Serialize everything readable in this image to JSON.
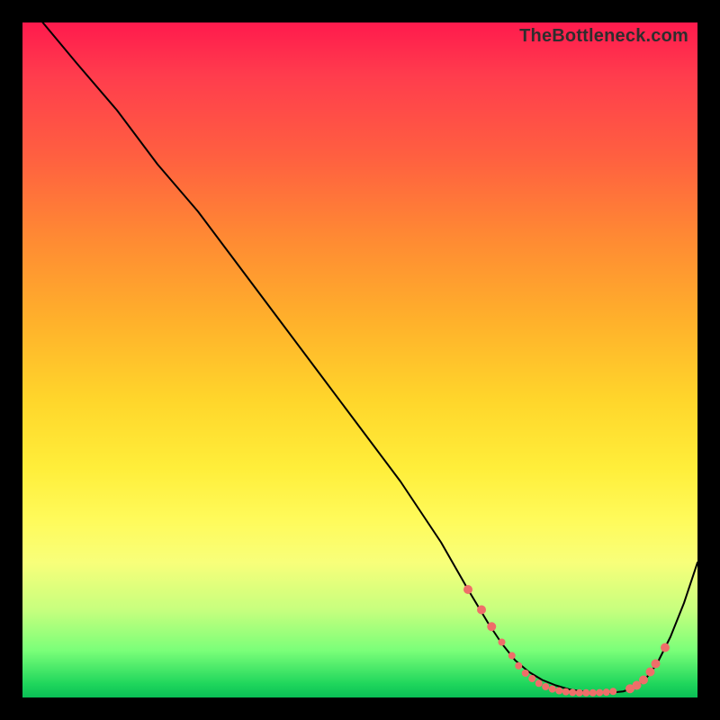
{
  "watermark": "TheBottleneck.com",
  "colors": {
    "frame": "#000000",
    "marker": "#ef6e69",
    "line": "#000000"
  },
  "chart_data": {
    "type": "line",
    "title": "",
    "xlabel": "",
    "ylabel": "",
    "xlim": [
      0,
      100
    ],
    "ylim": [
      0,
      100
    ],
    "grid": false,
    "series": [
      {
        "name": "bottleneck-curve",
        "x": [
          3,
          8,
          14,
          20,
          26,
          32,
          38,
          44,
          50,
          56,
          62,
          66,
          69,
          71,
          73,
          75,
          77,
          79,
          81,
          83,
          85,
          87,
          89,
          91,
          92.5,
          94,
          96,
          98,
          100
        ],
        "y": [
          100,
          94,
          87,
          79,
          72,
          64,
          56,
          48,
          40,
          32,
          23,
          16,
          11,
          8,
          5.5,
          3.8,
          2.6,
          1.8,
          1.2,
          0.9,
          0.7,
          0.7,
          0.9,
          1.6,
          3,
          5,
          9,
          14,
          20
        ]
      }
    ],
    "markers": {
      "name": "highlight-points",
      "points": [
        {
          "x": 66,
          "y": 16,
          "r": 5
        },
        {
          "x": 68,
          "y": 13,
          "r": 5
        },
        {
          "x": 69.5,
          "y": 10.5,
          "r": 5
        },
        {
          "x": 71,
          "y": 8.2,
          "r": 4
        },
        {
          "x": 72.5,
          "y": 6.2,
          "r": 4
        },
        {
          "x": 73.5,
          "y": 4.7,
          "r": 4
        },
        {
          "x": 74.5,
          "y": 3.6,
          "r": 4
        },
        {
          "x": 75.5,
          "y": 2.8,
          "r": 4
        },
        {
          "x": 76.5,
          "y": 2.1,
          "r": 4
        },
        {
          "x": 77.5,
          "y": 1.6,
          "r": 4
        },
        {
          "x": 78.5,
          "y": 1.25,
          "r": 4
        },
        {
          "x": 79.5,
          "y": 1.0,
          "r": 4
        },
        {
          "x": 80.5,
          "y": 0.85,
          "r": 4
        },
        {
          "x": 81.5,
          "y": 0.75,
          "r": 4
        },
        {
          "x": 82.5,
          "y": 0.7,
          "r": 4
        },
        {
          "x": 83.5,
          "y": 0.7,
          "r": 4
        },
        {
          "x": 84.5,
          "y": 0.7,
          "r": 4
        },
        {
          "x": 85.5,
          "y": 0.72,
          "r": 4
        },
        {
          "x": 86.5,
          "y": 0.78,
          "r": 4
        },
        {
          "x": 87.5,
          "y": 0.9,
          "r": 4
        },
        {
          "x": 90,
          "y": 1.3,
          "r": 5
        },
        {
          "x": 91,
          "y": 1.8,
          "r": 5
        },
        {
          "x": 92,
          "y": 2.6,
          "r": 5
        },
        {
          "x": 93,
          "y": 3.8,
          "r": 5
        },
        {
          "x": 93.8,
          "y": 5.0,
          "r": 5
        },
        {
          "x": 95.2,
          "y": 7.4,
          "r": 5
        }
      ]
    }
  }
}
